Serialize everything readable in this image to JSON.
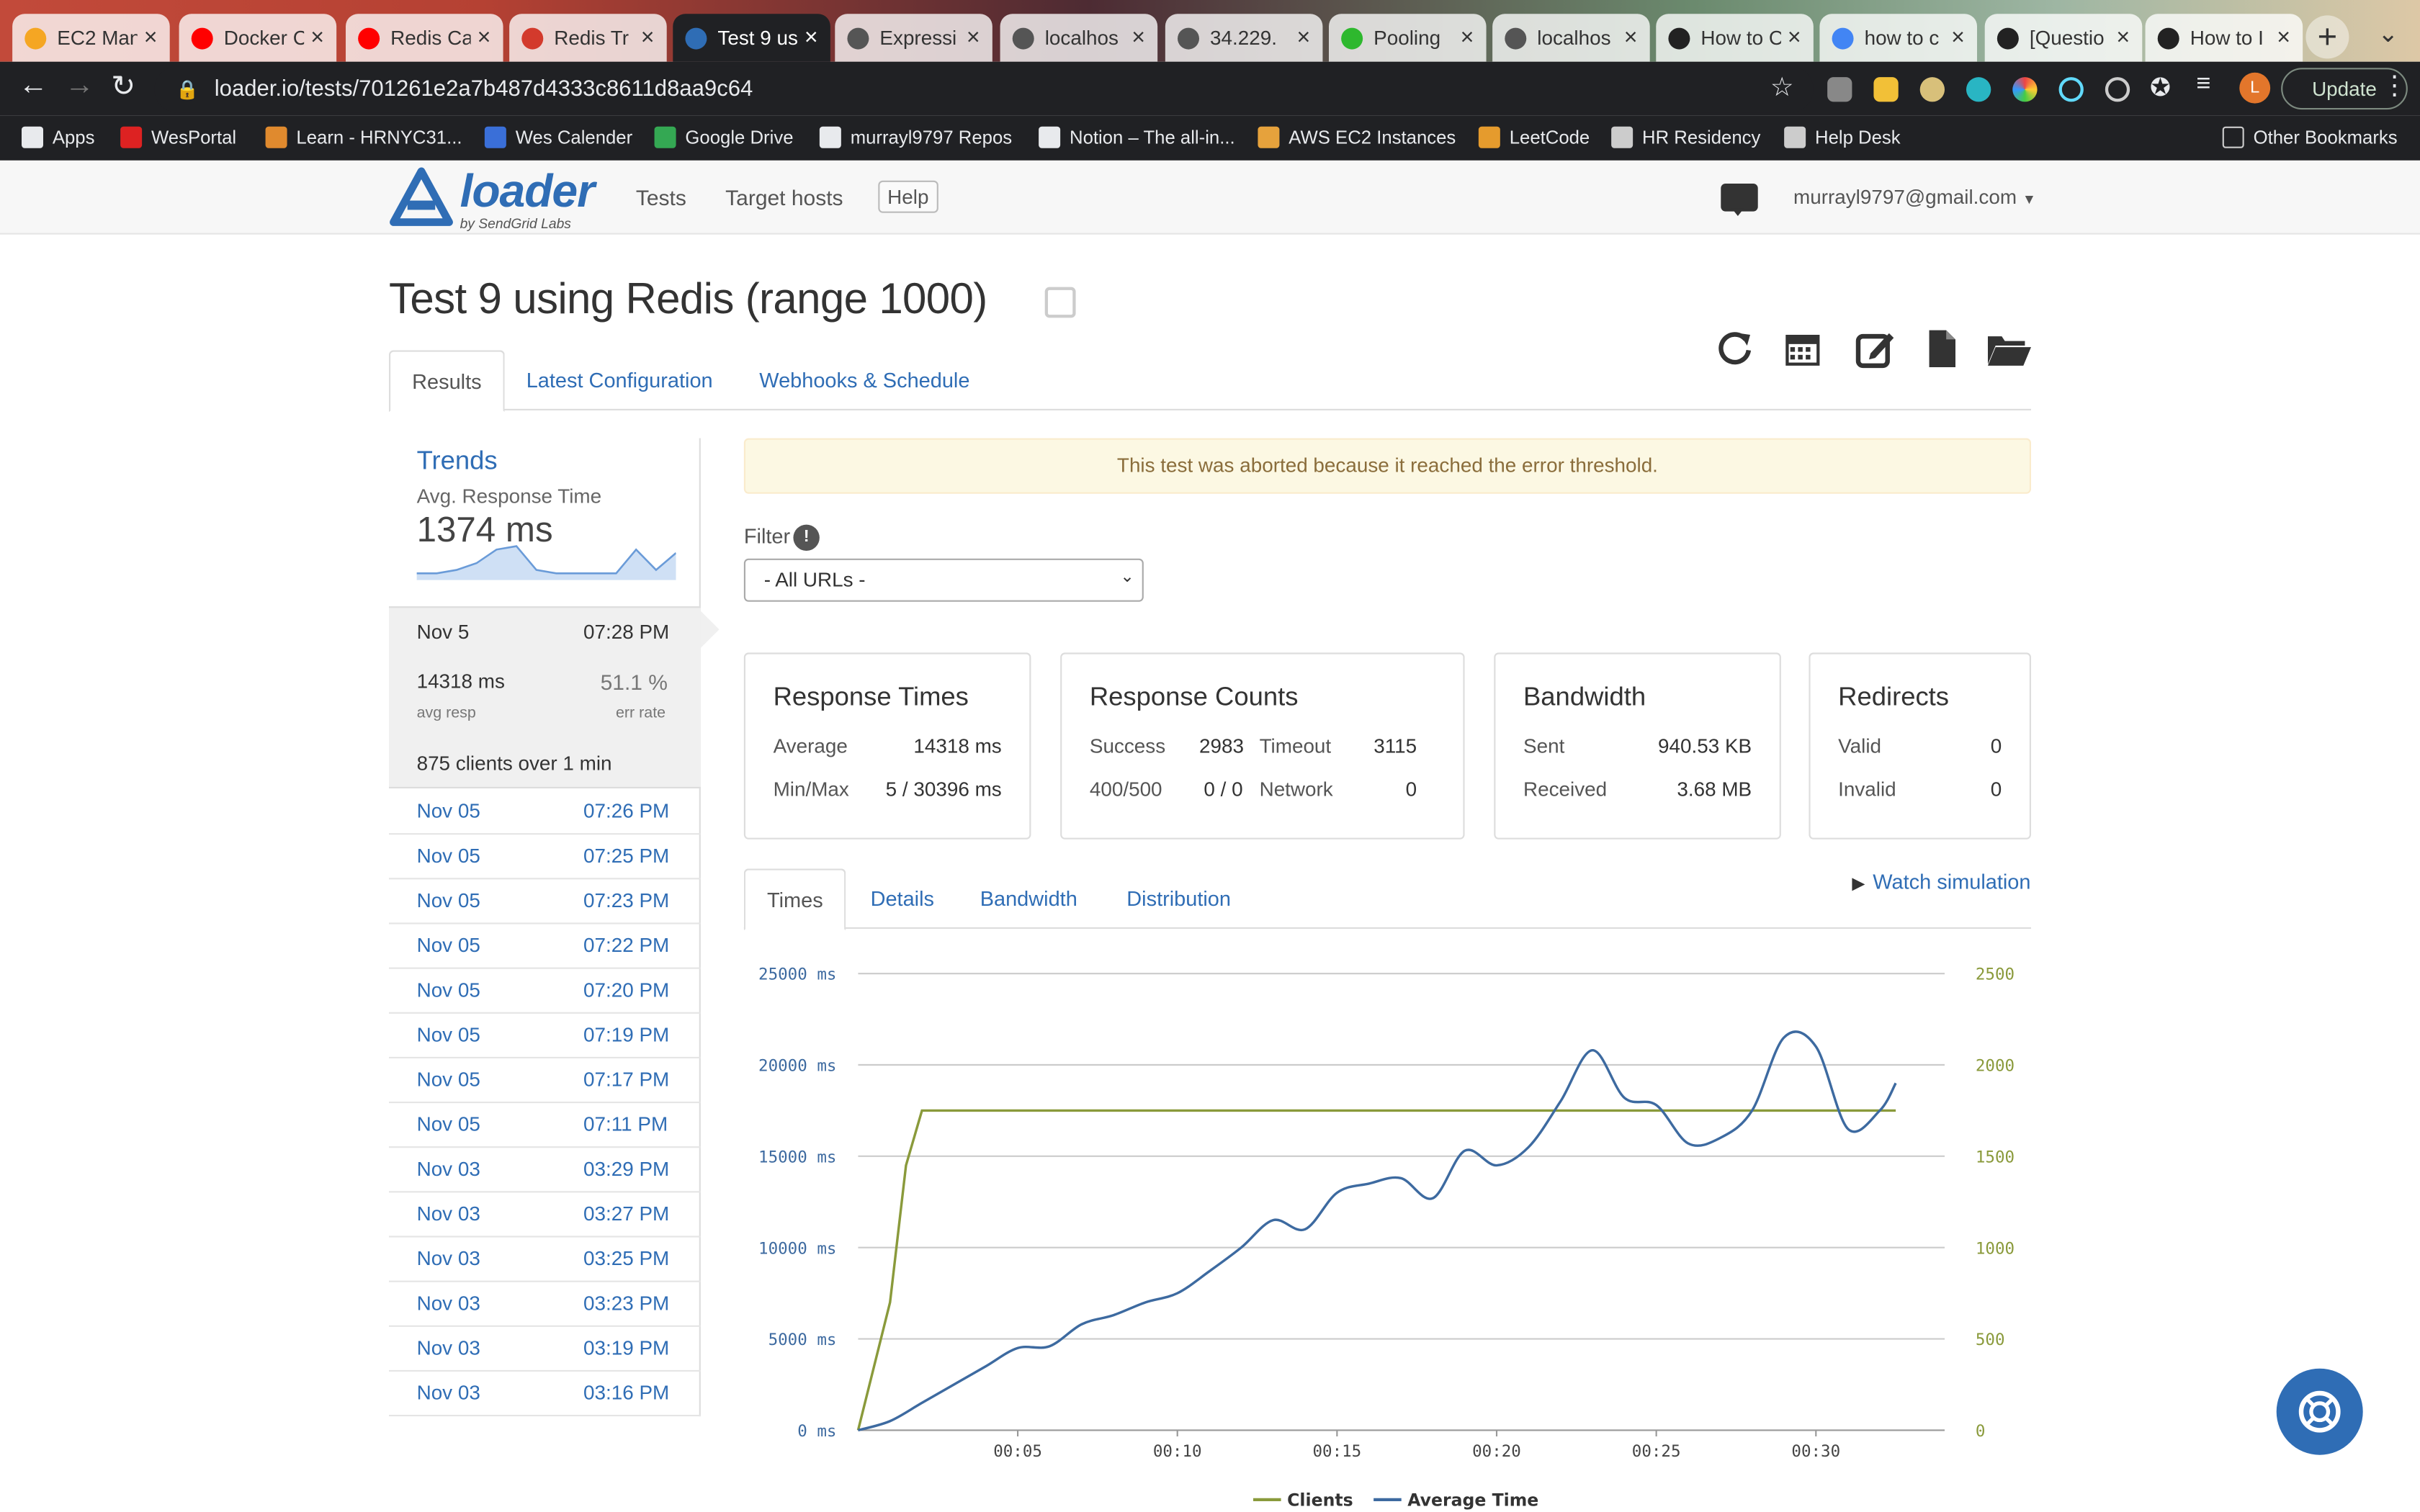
{
  "browser": {
    "tabs": [
      {
        "title": "EC2 Man",
        "color": "#f5a623"
      },
      {
        "title": "Docker C",
        "color": "#ff0000"
      },
      {
        "title": "Redis Ca",
        "color": "#ff0000"
      },
      {
        "title": "Redis Tr",
        "color": "#d33a2c"
      },
      {
        "title": "Test 9 us",
        "color": "#2f6db5"
      },
      {
        "title": "Expressi",
        "color": "#555555"
      },
      {
        "title": "localhos",
        "color": "#555555"
      },
      {
        "title": "34.229.",
        "color": "#555555"
      },
      {
        "title": "Pooling",
        "color": "#2eb82e"
      },
      {
        "title": "localhos",
        "color": "#555555"
      },
      {
        "title": "How to C",
        "color": "#222222"
      },
      {
        "title": "how to c",
        "color": "#4285f4"
      },
      {
        "title": "[Questio",
        "color": "#222222"
      },
      {
        "title": "How to I",
        "color": "#222222"
      }
    ],
    "active_tab": 4,
    "url": "loader.io/tests/701261e2a7b487d4333c8611d8aa9c64",
    "update_label": "Update",
    "avatar_letter": "L",
    "bookmarks": [
      "Apps",
      "WesPortal",
      "Learn - HRNYC31...",
      "Wes Calender",
      "Google Drive",
      "murrayl9797 Repos",
      "Notion – The all-in...",
      "AWS EC2 Instances",
      "LeetCode",
      "HR Residency",
      "Help Desk"
    ],
    "other_bookmarks": "Other Bookmarks"
  },
  "app": {
    "logo_word": "loader",
    "logo_by": "by SendGrid Labs",
    "nav": {
      "tests": "Tests",
      "target_hosts": "Target hosts",
      "help": "Help"
    },
    "user_email": "murrayl9797@gmail.com"
  },
  "page": {
    "title": "Test 9 using Redis (range 1000)",
    "tabs": {
      "results": "Results",
      "latest_config": "Latest Configuration",
      "webhooks": "Webhooks & Schedule"
    }
  },
  "sidebar": {
    "trends_title": "Trends",
    "trends_subtitle": "Avg. Response Time",
    "trends_value": "1374 ms",
    "sparkline": [
      2,
      2,
      3,
      5,
      9,
      10,
      3,
      2,
      2,
      2,
      2,
      9,
      3,
      8
    ],
    "selected": {
      "date": "Nov 5",
      "time": "07:28 PM",
      "avg_resp": "14318 ms",
      "avg_resp_label": "avg resp",
      "err_rate": "51.1 %",
      "err_rate_label": "err rate",
      "clients": "875 clients over 1 min"
    },
    "runs": [
      {
        "date": "Nov 05",
        "time": "07:26 PM"
      },
      {
        "date": "Nov 05",
        "time": "07:25 PM"
      },
      {
        "date": "Nov 05",
        "time": "07:23 PM"
      },
      {
        "date": "Nov 05",
        "time": "07:22 PM"
      },
      {
        "date": "Nov 05",
        "time": "07:20 PM"
      },
      {
        "date": "Nov 05",
        "time": "07:19 PM"
      },
      {
        "date": "Nov 05",
        "time": "07:17 PM"
      },
      {
        "date": "Nov 05",
        "time": "07:11 PM"
      },
      {
        "date": "Nov 03",
        "time": "03:29 PM"
      },
      {
        "date": "Nov 03",
        "time": "03:27 PM"
      },
      {
        "date": "Nov 03",
        "time": "03:25 PM"
      },
      {
        "date": "Nov 03",
        "time": "03:23 PM"
      },
      {
        "date": "Nov 03",
        "time": "03:19 PM"
      },
      {
        "date": "Nov 03",
        "time": "03:16 PM"
      }
    ]
  },
  "main": {
    "alert": "This test was aborted because it reached the error threshold.",
    "filter_label": "Filter",
    "filter_value": "- All URLs -",
    "cards": {
      "response_times": {
        "title": "Response Times",
        "average_label": "Average",
        "average": "14318 ms",
        "minmax_label": "Min/Max",
        "minmax": "5 / 30396 ms"
      },
      "response_counts": {
        "title": "Response Counts",
        "success_label": "Success",
        "success": "2983",
        "timeout_label": "Timeout",
        "timeout": "3115",
        "e400_label": "400/500",
        "e400": "0 / 0",
        "network_label": "Network",
        "network": "0"
      },
      "bandwidth": {
        "title": "Bandwidth",
        "sent_label": "Sent",
        "sent": "940.53 KB",
        "received_label": "Received",
        "received": "3.68 MB"
      },
      "redirects": {
        "title": "Redirects",
        "valid_label": "Valid",
        "valid": "0",
        "invalid_label": "Invalid",
        "invalid": "0"
      }
    },
    "chart_tabs": {
      "times": "Times",
      "details": "Details",
      "bandwidth": "Bandwidth",
      "distribution": "Distribution"
    },
    "watch_simulation": "Watch simulation"
  },
  "chart_data": {
    "type": "line",
    "x_ticks": [
      "00:05",
      "00:10",
      "00:15",
      "00:20",
      "00:25",
      "00:30"
    ],
    "ylim_left": [
      0,
      25000
    ],
    "ylim_right": [
      0,
      2500
    ],
    "y_left_ticks": [
      "0 ms",
      "5000 ms",
      "10000 ms",
      "15000 ms",
      "20000 ms",
      "25000 ms"
    ],
    "y_right_ticks": [
      "0",
      "500",
      "1000",
      "1500",
      "2000",
      "2500"
    ],
    "legend_position": "bottom",
    "grid": true,
    "colors": {
      "clients": "#8a9a3b",
      "average_time": "#3d6aa0"
    },
    "series": [
      {
        "name": "Clients",
        "axis": "right",
        "x": [
          0,
          1,
          1.5,
          2,
          3,
          5,
          10,
          15,
          20,
          25,
          30,
          32.5
        ],
        "values": [
          0,
          700,
          1450,
          1750,
          1750,
          1750,
          1750,
          1750,
          1750,
          1750,
          1750,
          1750
        ]
      },
      {
        "name": "Average Time",
        "axis": "left",
        "x": [
          0,
          1,
          2,
          3,
          4,
          5,
          6,
          7,
          8,
          9,
          10,
          11,
          12,
          13,
          14,
          15,
          16,
          17,
          18,
          19,
          20,
          21,
          22,
          23,
          24,
          25,
          26,
          27,
          28,
          29,
          30,
          31,
          32,
          32.5
        ],
        "values": [
          0,
          500,
          1500,
          2500,
          3500,
          4500,
          4600,
          5800,
          6300,
          7000,
          7500,
          8700,
          10000,
          11500,
          11000,
          13000,
          13500,
          13800,
          12700,
          15300,
          14500,
          15500,
          18000,
          20800,
          18200,
          17800,
          15700,
          16000,
          17500,
          21500,
          21000,
          16500,
          17500,
          19000
        ]
      }
    ]
  }
}
